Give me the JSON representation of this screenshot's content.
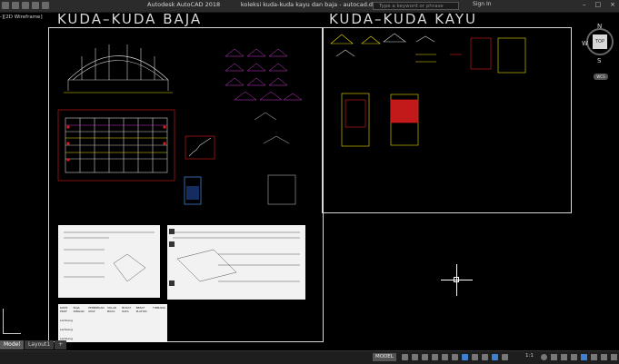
{
  "titlebar": {
    "app_title": "Autodesk AutoCAD 2018",
    "file_title": "koleksi kuda-kuda kayu dan baja - autocad.dwg",
    "search_placeholder": "Type a keyword or phrase",
    "sign_in": "Sign In"
  },
  "viewport": {
    "label": "-][2D Wireframe]"
  },
  "sheets": {
    "left_title": "KUDA–KUDA BAJA",
    "right_title": "KUDA–KUDA KAYU"
  },
  "viewcube": {
    "north": "N",
    "west": "W",
    "south": "S",
    "face": "TOP",
    "wcs": "WCS"
  },
  "tabs": [
    "Model",
    "Layout1",
    "+"
  ],
  "statusbar": {
    "model": "MODEL",
    "scale": "1:1"
  },
  "colors": {
    "background": "#000000",
    "frame": "#d8d8d8",
    "accent_red": "#e01b1b",
    "accent_yellow": "#e8e000",
    "accent_magenta": "#d43bd4",
    "accent_blue": "#3d7fd0"
  },
  "table_panel": {
    "headers": [
      "KODE PROF",
      "BAJA RINGAN",
      "PEMBERIAN ATAP",
      "SOLAR BIAYA",
      "BUKAT RATA",
      "BERAT PLAFON",
      "TIMBANG"
    ],
    "rows": [
      [
        "Lembang",
        "",
        "",
        "",
        "",
        "",
        ""
      ],
      [
        "Lembang",
        "",
        "",
        "",
        "",
        "",
        ""
      ],
      [
        "Lembang",
        "",
        "",
        "",
        "",
        "",
        ""
      ]
    ]
  }
}
